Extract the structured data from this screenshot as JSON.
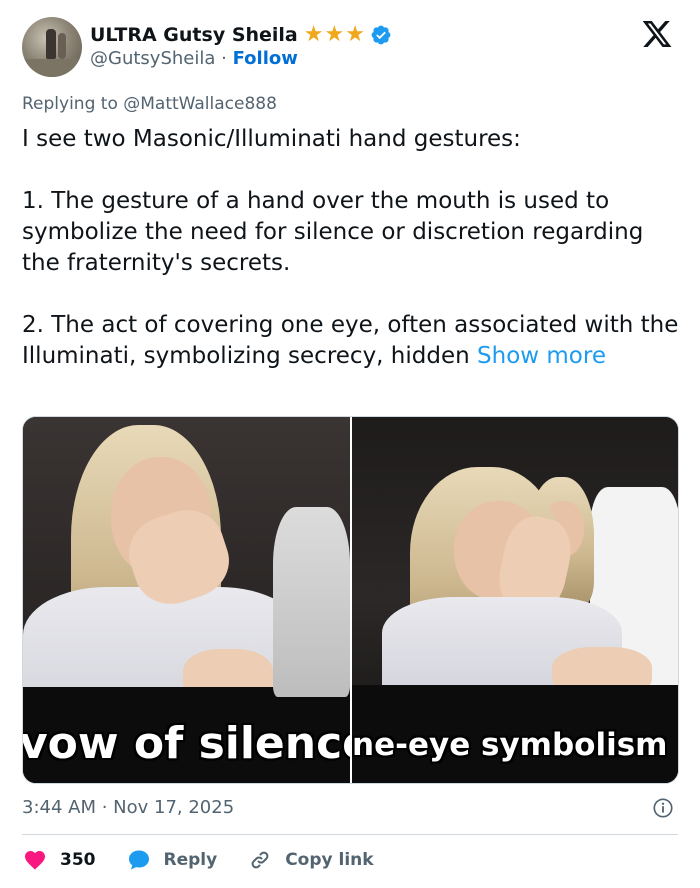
{
  "header": {
    "display_name": "ULTRA Gutsy Sheila",
    "stars": "★★★",
    "handle": "@GutsySheila",
    "separator": "·",
    "follow_label": "Follow",
    "star_color": "#f0a81c",
    "verified_color": "#1d9bf0"
  },
  "tweet": {
    "replying_to": "Replying to @MattWallace888",
    "paragraphs": [
      "I see two Masonic/Illuminati hand gestures:",
      "1. The gesture of a hand over the mouth is used to symbolize the need for silence or discretion regarding the fraternity's secrets.",
      "2. The act of covering one eye, often associated with the Illuminati, symbolizing secrecy, hidden"
    ],
    "show_more": "Show more",
    "link_color": "#1d9bf0"
  },
  "media": {
    "left_caption": "vow of silence",
    "right_caption": "ne-eye symbolism"
  },
  "meta": {
    "timestamp": "3:44 AM · Nov 17, 2025"
  },
  "actions": {
    "like_count": "350",
    "reply_label": "Reply",
    "copy_link_label": "Copy link",
    "like_color": "#f91880",
    "reply_color": "#1d9bf0"
  },
  "icons": [
    "avatar",
    "star-icon",
    "verified-icon",
    "x-logo-icon",
    "info-icon",
    "heart-icon",
    "reply-bubble-icon",
    "link-icon"
  ]
}
